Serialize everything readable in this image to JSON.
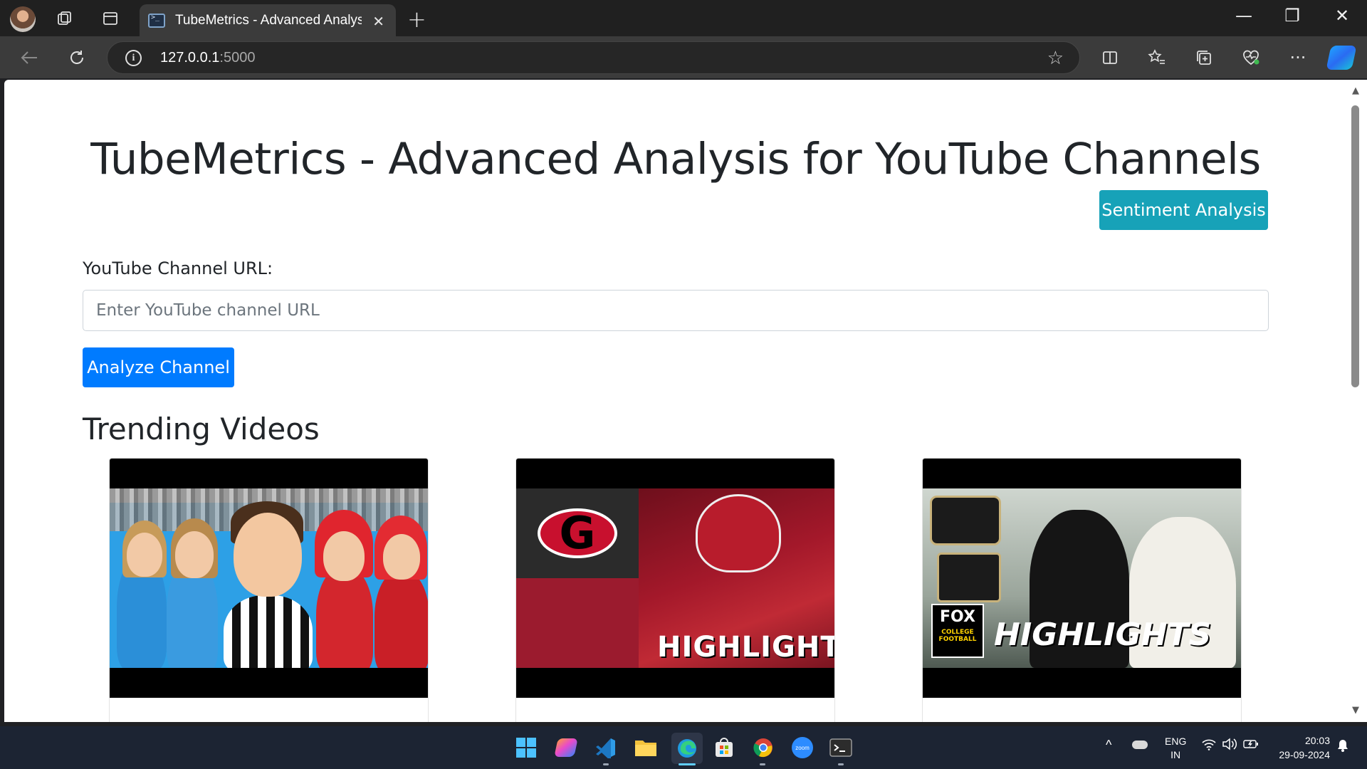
{
  "browser": {
    "tab_title": "TubeMetrics - Advanced Analysis for YouTube Channels",
    "tab_close": "✕",
    "new_tab": "+",
    "url_host": "127.0.0.1",
    "url_port": ":5000",
    "window_controls": {
      "minimize": "—",
      "restore": "❐",
      "close": "✕"
    }
  },
  "page": {
    "title": "TubeMetrics - Advanced Analysis for YouTube Channels",
    "sentiment_button": "Sentiment Analysis",
    "channel_label": "YouTube Channel URL:",
    "channel_placeholder": "Enter YouTube channel URL",
    "channel_value": "",
    "analyze_button": "Analyze Channel",
    "trending_heading": "Trending Videos",
    "videos": [
      {
        "thumbnail_text": ""
      },
      {
        "thumbnail_text": "HIGHLIGHTS"
      },
      {
        "thumbnail_text": "HIGHLIGHTS",
        "badge": "FOX",
        "badge_sub": "COLLEGE FOOTBALL"
      }
    ]
  },
  "taskbar": {
    "lang_top": "ENG",
    "lang_bottom": "IN",
    "time": "20:03",
    "date": "29-09-2024"
  },
  "colors": {
    "primary": "#007bff",
    "info": "#17a2b8",
    "taskbar": "#1c2433",
    "browser_frame": "#202020"
  }
}
